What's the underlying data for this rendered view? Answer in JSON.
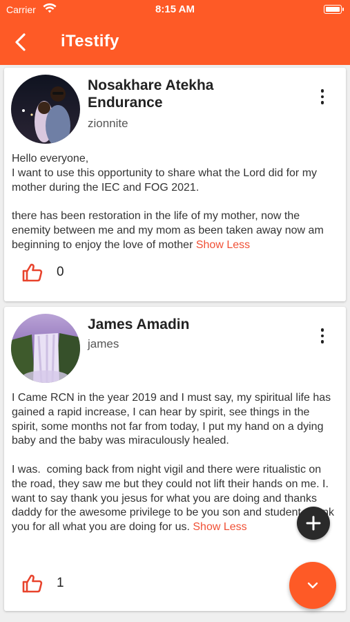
{
  "status_bar": {
    "carrier": "Carrier",
    "time": "8:15 AM"
  },
  "nav": {
    "title": "iTestify"
  },
  "posts": [
    {
      "name": "Nosakhare Atekha Endurance",
      "username": "zionnite",
      "body": "Hello everyone,\nI want to use this opportunity to share what the Lord did for my mother during the IEC and FOG 2021.\n\nthere has been restoration in the life of my mother, now the enemity between me and my mom as been taken away now am beginning to enjoy the love of mother ",
      "toggle": "Show Less",
      "likes": "0"
    },
    {
      "name": "James Amadin",
      "username": "james",
      "body": "I Came RCN in the year 2019 and I must say, my spiritual life has gained a rapid increase, I can hear by spirit, see things in the spirit, some months not far from today, I put my hand on a dying baby and the baby was miraculously healed.\n\nI was.  coming back from night vigil and there were ritualistic on the road, they saw me but they could not lift their hands on me. I.  want to say thank you jesus for what you are doing and thanks daddy for the awesome privilege to be you son and student, thank you for all what you are doing for us. ",
      "toggle": "Show Less",
      "likes": "1"
    }
  ],
  "colors": {
    "accent": "#fe5a26",
    "link": "#f05035",
    "fab_dark": "#2a2a2a"
  },
  "icons": {
    "back": "chevron-left-icon",
    "menu": "more-vertical-icon",
    "like": "thumbs-up-icon",
    "add": "plus-icon",
    "scroll": "chevron-down-icon"
  }
}
